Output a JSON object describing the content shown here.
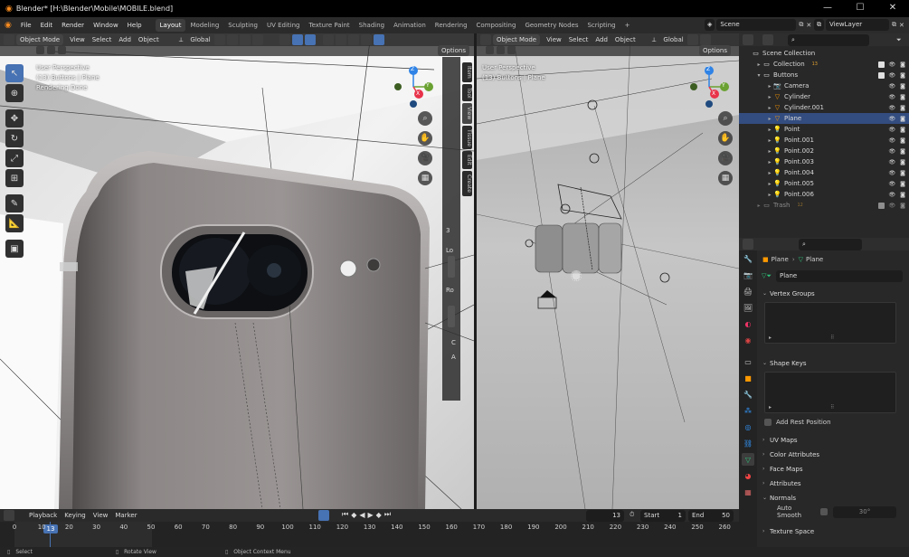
{
  "window": {
    "title": "Blender* [H:\\Blender\\Mobile\\MOBILE.blend]",
    "minimize": "—",
    "maximize": "☐",
    "close": "✕"
  },
  "menu": {
    "items": [
      "File",
      "Edit",
      "Render",
      "Window",
      "Help"
    ]
  },
  "workspaces": [
    "Layout",
    "Modeling",
    "Sculpting",
    "UV Editing",
    "Texture Paint",
    "Shading",
    "Animation",
    "Rendering",
    "Compositing",
    "Geometry Nodes",
    "Scripting"
  ],
  "workspace_active": "Layout",
  "add_workspace": "+",
  "scene": {
    "name": "Scene",
    "view_layer": "ViewLayer"
  },
  "viewport_left": {
    "mode": "Object Mode",
    "menus": [
      "View",
      "Select",
      "Add",
      "Object"
    ],
    "orientation": "Global",
    "options": "Options",
    "overlay_lines": [
      "User Perspective",
      "(13) Buttons | Plane",
      "Rendering Done"
    ],
    "sidebar_tabs": [
      "Item",
      "Tool",
      "View",
      "Tissue",
      "Edit",
      "Create"
    ],
    "sidebar_labels": [
      "3",
      "Lo",
      "Ro",
      "C",
      "A"
    ],
    "gizmo": {
      "x": "X",
      "y": "Y",
      "z": "Z"
    }
  },
  "viewport_right": {
    "mode": "Object Mode",
    "menus": [
      "View",
      "Select",
      "Add",
      "Object"
    ],
    "orientation": "Global",
    "options": "Options",
    "overlay_lines": [
      "User Perspective",
      "(13) Buttons | Plane"
    ],
    "gizmo": {
      "x": "X",
      "y": "Y",
      "z": "Z"
    }
  },
  "outliner": {
    "search_placeholder": "",
    "rows": [
      {
        "label": "Scene Collection",
        "indent": 0,
        "icon": "collection",
        "tri": ""
      },
      {
        "label": "Collection",
        "indent": 1,
        "icon": "collection",
        "tri": "▸",
        "badge": "13"
      },
      {
        "label": "Buttons",
        "indent": 1,
        "icon": "collection",
        "tri": "▾"
      },
      {
        "label": "Camera",
        "indent": 2,
        "icon": "camera",
        "tri": "▸"
      },
      {
        "label": "Cylinder",
        "indent": 2,
        "icon": "mesh",
        "tri": "▸"
      },
      {
        "label": "Cylinder.001",
        "indent": 2,
        "icon": "mesh",
        "tri": "▸"
      },
      {
        "label": "Plane",
        "indent": 2,
        "icon": "mesh",
        "tri": "▸",
        "selected": true
      },
      {
        "label": "Point",
        "indent": 2,
        "icon": "light",
        "tri": "▸"
      },
      {
        "label": "Point.001",
        "indent": 2,
        "icon": "light",
        "tri": "▸"
      },
      {
        "label": "Point.002",
        "indent": 2,
        "icon": "light",
        "tri": "▸"
      },
      {
        "label": "Point.003",
        "indent": 2,
        "icon": "light",
        "tri": "▸"
      },
      {
        "label": "Point.004",
        "indent": 2,
        "icon": "light",
        "tri": "▸"
      },
      {
        "label": "Point.005",
        "indent": 2,
        "icon": "light",
        "tri": "▸"
      },
      {
        "label": "Point.006",
        "indent": 2,
        "icon": "light",
        "tri": "▸"
      },
      {
        "label": "Trash",
        "indent": 1,
        "icon": "collection",
        "tri": "▸",
        "badge": "12",
        "dim": true
      }
    ]
  },
  "properties": {
    "breadcrumb": {
      "object": "Plane",
      "data": "Plane"
    },
    "data_name": "Plane",
    "panels": {
      "vertex_groups": "Vertex Groups",
      "shape_keys": "Shape Keys",
      "add_rest_position": "Add Rest Position",
      "uv_maps": "UV Maps",
      "color_attributes": "Color Attributes",
      "face_maps": "Face Maps",
      "attributes": "Attributes",
      "normals": "Normals",
      "auto_smooth": "Auto Smooth",
      "auto_smooth_angle": "30°",
      "texture_space": "Texture Space"
    }
  },
  "timeline": {
    "menus": [
      "Playback",
      "Keying",
      "View",
      "Marker"
    ],
    "current_frame": "13",
    "start_label": "Start",
    "start": "1",
    "end_label": "End",
    "end": "50",
    "ticks": [
      "0",
      "10",
      "20",
      "30",
      "40",
      "50",
      "60",
      "70",
      "80",
      "90",
      "100",
      "110",
      "120",
      "130",
      "140",
      "150",
      "160",
      "170",
      "180",
      "190",
      "200",
      "210",
      "220",
      "230",
      "240",
      "250",
      "260"
    ],
    "playhead_label": "13"
  },
  "status": {
    "select": "Select",
    "rotate": "Rotate View",
    "context": "Object Context Menu"
  },
  "colors": {
    "accent": "#4772b3",
    "selected_row": "#334d80",
    "axis_x": "#e8334a",
    "axis_y": "#6aa132",
    "axis_z": "#2f83e6"
  }
}
